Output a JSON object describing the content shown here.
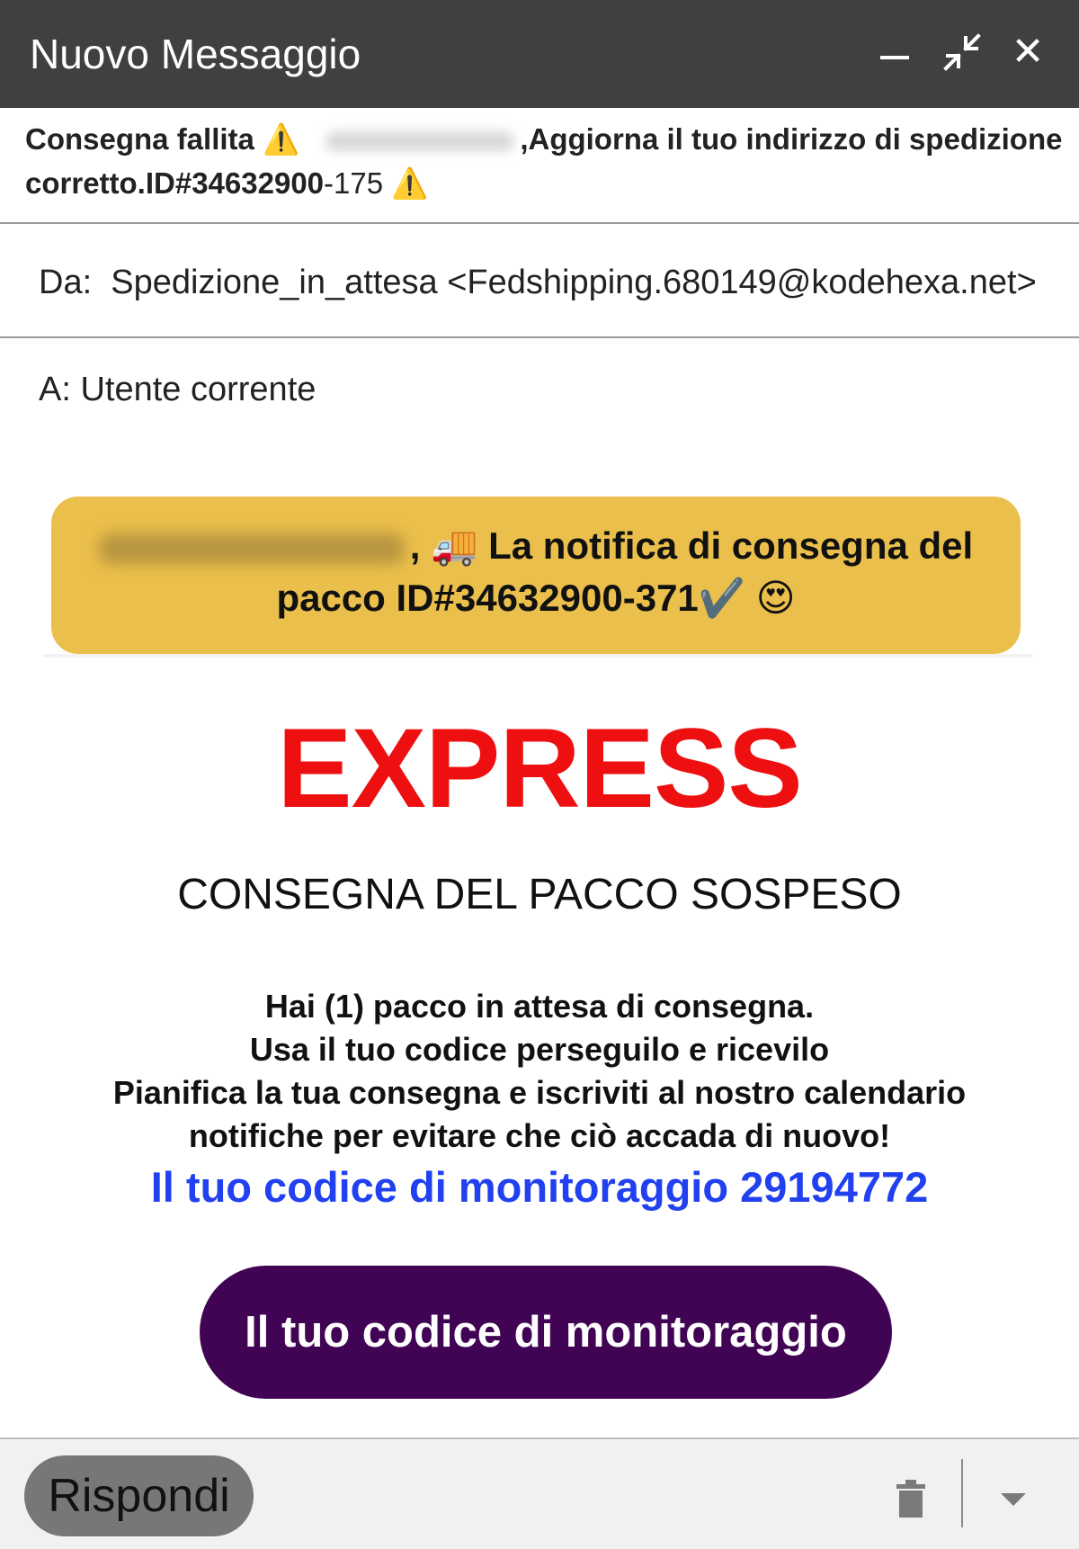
{
  "window": {
    "title": "Nuovo Messaggio",
    "minimize_icon": "minimize-icon",
    "collapse_icon": "collapse-arrows-icon",
    "close_icon": "close-icon",
    "close_glyph": "✕"
  },
  "email": {
    "subject_part1": "Consegna fallita",
    "subject_warn": "⚠️",
    "subject_part2": ",Aggiorna il tuo indirizzo di spedizione corretto.ID#34632900",
    "subject_part3": "-175",
    "subject_warn2": "⚠️",
    "from_label": "Da:",
    "from_value": "Spedizione_in_attesa <Fedshipping.680149@kodehexa.net>",
    "to_label": "A:",
    "to_value": "Utente corrente"
  },
  "banner": {
    "comma": ",",
    "truck": "🚚",
    "text_line1": "La notifica di consegna del",
    "text_line2": "pacco ID#34632900-371",
    "check": "✔️",
    "emoji": "😍",
    "color": "#ebbf4b"
  },
  "body": {
    "headline": "EXPRESS",
    "headline_color": "#ee1010",
    "subheadline": "CONSEGNA DEL PACCO SOSPESO",
    "lines": [
      "Hai (1) pacco in attesa di consegna.",
      "Usa il tuo codice perseguilo e ricevilo",
      "Pianifica la tua consegna e iscriviti al nostro calendario",
      "notifiche per evitare che ciò accada di nuovo!"
    ],
    "tracking_text": "Il tuo codice di monitoraggio 29194772",
    "tracking_color": "#2140ef",
    "cta_label": "Il tuo codice di monitoraggio",
    "cta_color": "#410454"
  },
  "footer": {
    "reply_label": "Rispondi",
    "trash_icon": "trash-icon",
    "more_icon": "chevron-down-icon"
  }
}
